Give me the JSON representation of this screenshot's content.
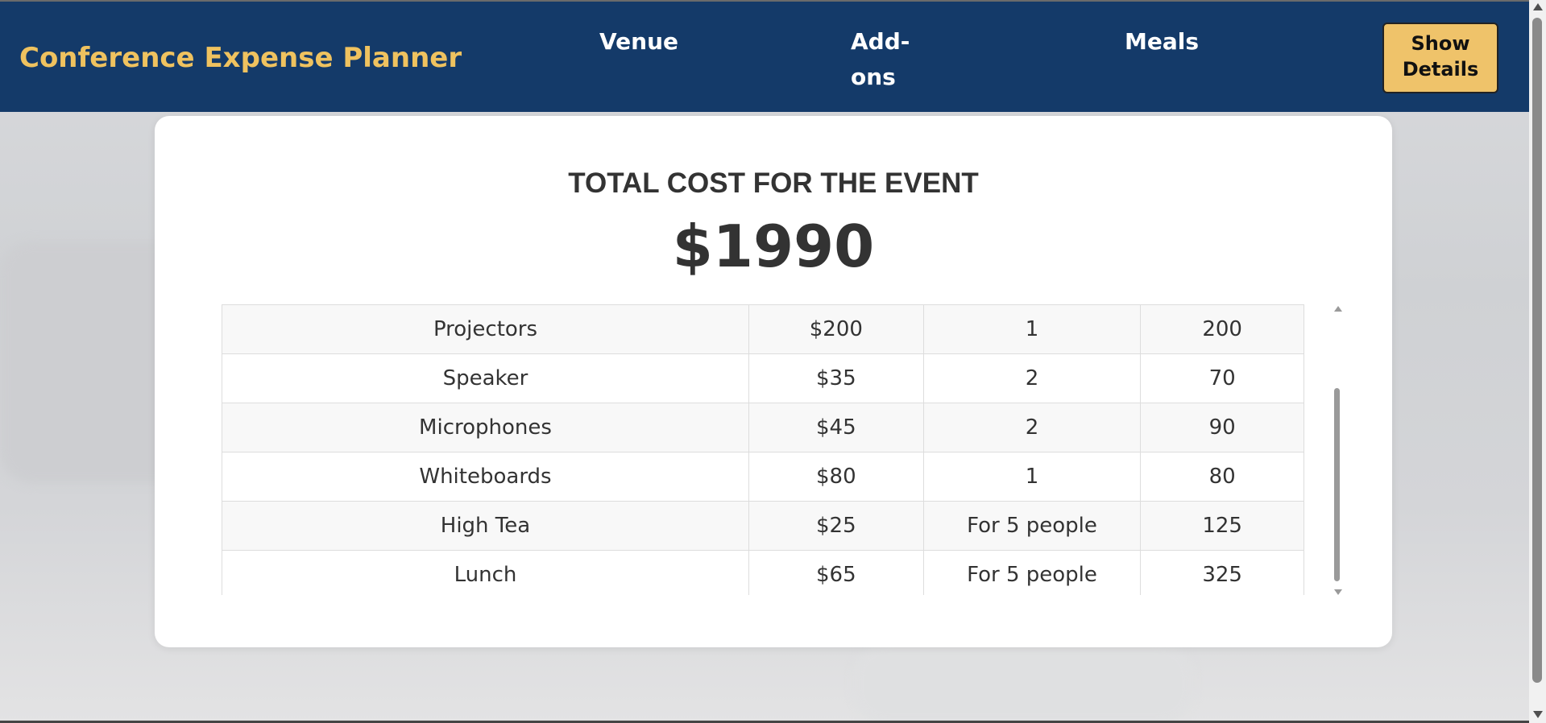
{
  "header": {
    "brand": "Conference Expense Planner",
    "nav": {
      "venue": "Venue",
      "addons": "Add-ons",
      "meals": "Meals"
    },
    "show_details": "Show Details"
  },
  "summary": {
    "title": "TOTAL COST FOR THE EVENT",
    "total": "$1990"
  },
  "table": {
    "rows": [
      {
        "name": "Projectors",
        "unit_cost": "$200",
        "quantity": "1",
        "subtotal": "200"
      },
      {
        "name": "Speaker",
        "unit_cost": "$35",
        "quantity": "2",
        "subtotal": "70"
      },
      {
        "name": "Microphones",
        "unit_cost": "$45",
        "quantity": "2",
        "subtotal": "90"
      },
      {
        "name": "Whiteboards",
        "unit_cost": "$80",
        "quantity": "1",
        "subtotal": "80"
      },
      {
        "name": "High Tea",
        "unit_cost": "$25",
        "quantity": "For 5 people",
        "subtotal": "125"
      },
      {
        "name": "Lunch",
        "unit_cost": "$65",
        "quantity": "For 5 people",
        "subtotal": "325"
      }
    ]
  },
  "colors": {
    "navbar": "#143a69",
    "brand": "#efc25f",
    "button": "#efc36a"
  }
}
